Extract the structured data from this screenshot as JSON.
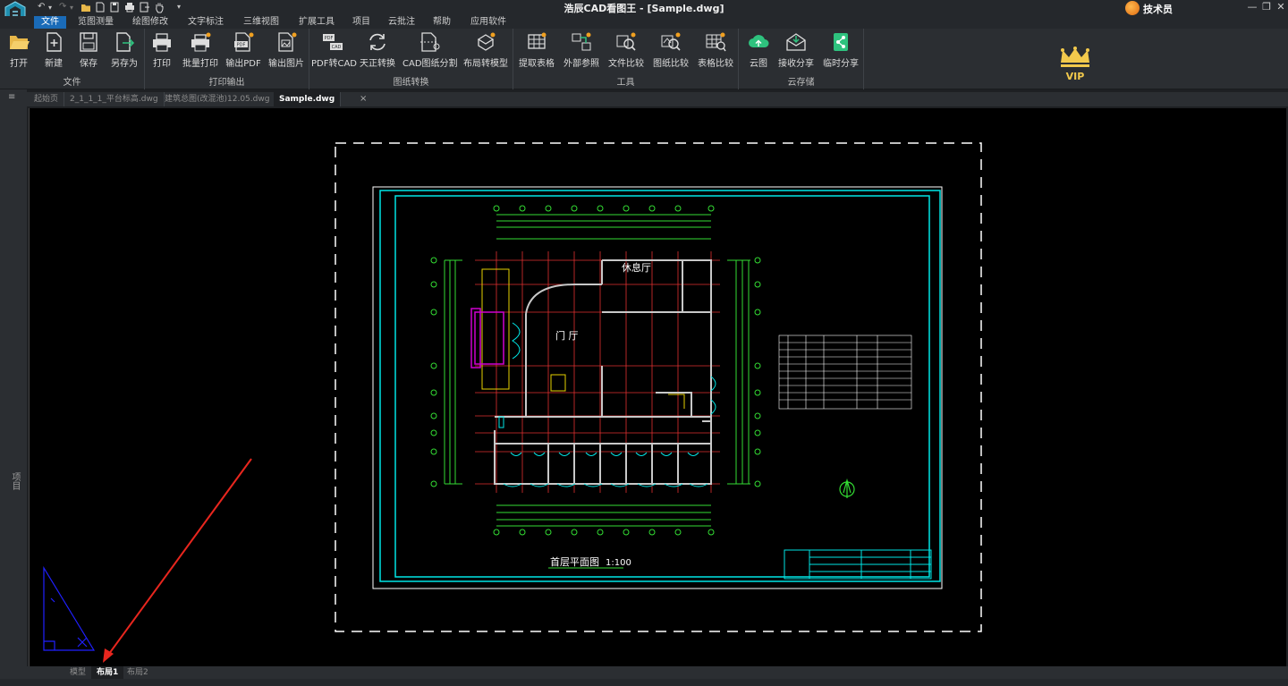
{
  "window": {
    "title": "浩辰CAD看图王 - [Sample.dwg]",
    "user_name": "技术员",
    "minimize": "—",
    "restore": "❐",
    "close": "✕"
  },
  "quick_access": [
    "↶",
    "▾",
    "↷",
    "▾"
  ],
  "menu": {
    "items": [
      "文件",
      "览图测量",
      "绘图修改",
      "文字标注",
      "三维视图",
      "扩展工具",
      "项目",
      "云批注",
      "帮助",
      "应用软件"
    ],
    "active": "文件"
  },
  "ribbon": {
    "groups": [
      {
        "label": "文件",
        "buttons": [
          "打开",
          "新建",
          "保存",
          "另存为"
        ]
      },
      {
        "label": "打印输出",
        "buttons": [
          "打印",
          "批量打印",
          "输出PDF",
          "输出图片"
        ]
      },
      {
        "label": "图纸转换",
        "buttons": [
          "PDF转CAD",
          "天正转换",
          "CAD图纸分割",
          "布局转模型"
        ]
      },
      {
        "label": "工具",
        "buttons": [
          "提取表格",
          "外部参照",
          "文件比较",
          "图纸比较",
          "表格比较"
        ]
      },
      {
        "label": "云存储",
        "buttons": [
          "云图",
          "接收分享",
          "临时分享"
        ]
      }
    ],
    "vip_label": "VIP"
  },
  "sidebar": {
    "label": "项目",
    "menu_icon": "≡"
  },
  "doc_tabs": {
    "tabs": [
      "起始页",
      "2_1_1_1_平台标高.dwg",
      "建筑总图(改混池)12.05.dwg",
      "Sample.dwg"
    ],
    "active": "Sample.dwg",
    "close": "×"
  },
  "drawing": {
    "room_labels": [
      "休息厅",
      "门 厅"
    ],
    "drawing_title": "首层平面图",
    "scale": "1:100"
  },
  "layout_tabs": {
    "tabs": [
      "模型",
      "布局1",
      "布局2"
    ],
    "active": "布局1"
  },
  "colors": {
    "accent": "#1a6bb8",
    "cad_cyan": "#00e5e5",
    "cad_red": "#e03030",
    "cad_green": "#33dd33",
    "cad_yellow": "#e6d200",
    "cad_magenta": "#d000d0",
    "cad_blue": "#2020ff",
    "annotation_arrow": "#e8261e"
  }
}
